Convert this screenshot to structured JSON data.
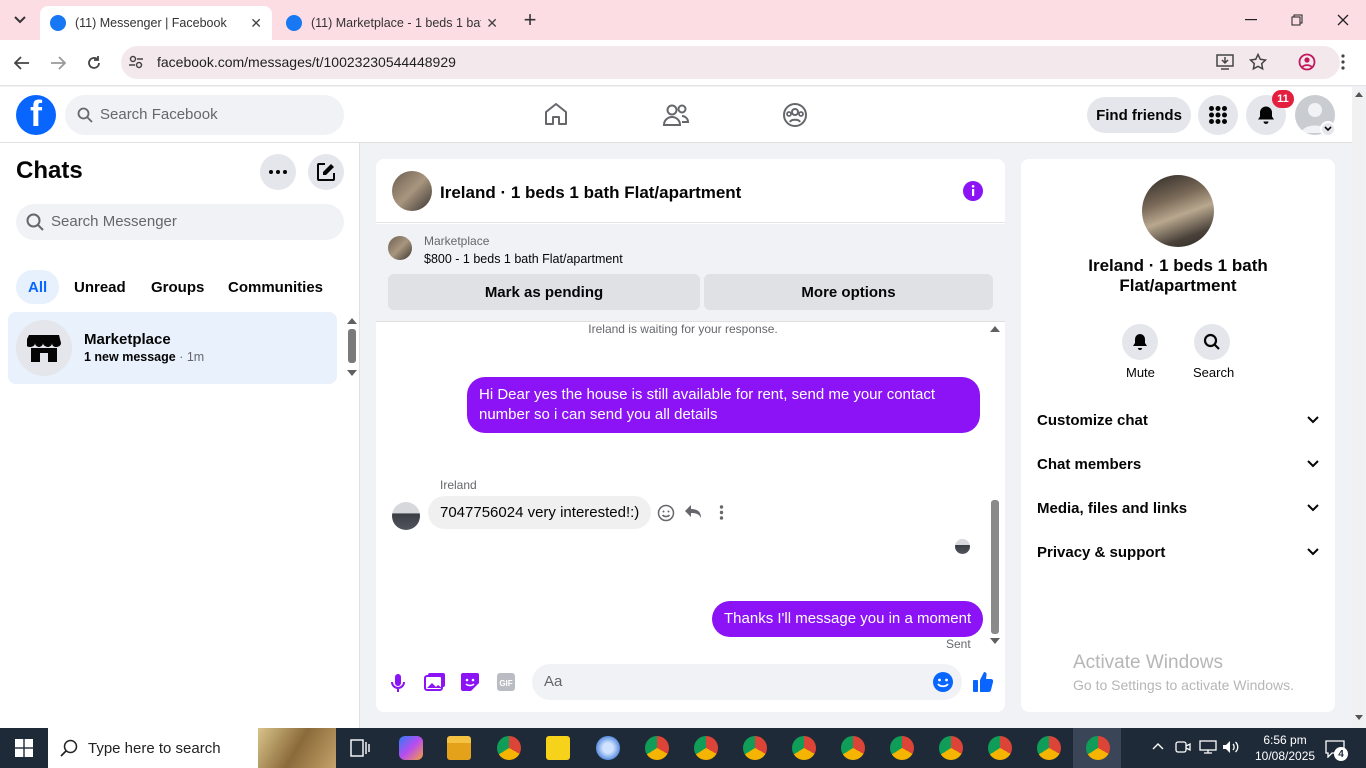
{
  "browser": {
    "tabs": [
      {
        "title": "(11) Messenger | Facebook",
        "active": true
      },
      {
        "title": "(11) Marketplace - 1 beds 1 bat",
        "active": false
      }
    ],
    "url": "facebook.com/messages/t/10023230544448929",
    "new_tab": "+",
    "close": "✕"
  },
  "fbnav": {
    "logo": "f",
    "search_placeholder": "Search Facebook",
    "find_friends": "Find friends",
    "notification_count": "11"
  },
  "chats": {
    "title": "Chats",
    "search_placeholder": "Search Messenger",
    "filters": [
      "All",
      "Unread",
      "Groups",
      "Communities"
    ],
    "items": [
      {
        "name": "Marketplace",
        "preview": "1 new message",
        "time": "· 1m"
      }
    ]
  },
  "conversation": {
    "title": "Ireland · 1 beds 1 bath Flat/apartment",
    "listing": {
      "label": "Marketplace",
      "detail": "$800 - 1 beds 1 bath Flat/apartment",
      "mark_pending": "Mark as pending",
      "more_options": "More options"
    },
    "waiting_notice": "Ireland is waiting for your response.",
    "messages": {
      "out1": "Hi Dear yes the house is still available for rent, send me your contact number so i can send you all details",
      "in_sender": "Ireland",
      "in1": "7047756024 very interested!:)",
      "out2": "Thanks I'll message you in a moment",
      "status": "Sent"
    },
    "composer_placeholder": "Aa"
  },
  "info": {
    "title": "Ireland · 1 beds 1 bath Flat/apartment",
    "mute": "Mute",
    "search": "Search",
    "sections": [
      "Customize chat",
      "Chat members",
      "Media, files and links",
      "Privacy & support"
    ]
  },
  "watermark": {
    "line1": "Activate Windows",
    "line2": "Go to Settings to activate Windows."
  },
  "taskbar": {
    "search_placeholder": "Type here to search",
    "time": "6:56 pm",
    "date": "10/08/2025",
    "notification_count": "4"
  },
  "colors": {
    "fb_blue": "#0866ff",
    "outgoing_bubble": "#8b13f5",
    "tab_strip": "#fbdde3"
  }
}
